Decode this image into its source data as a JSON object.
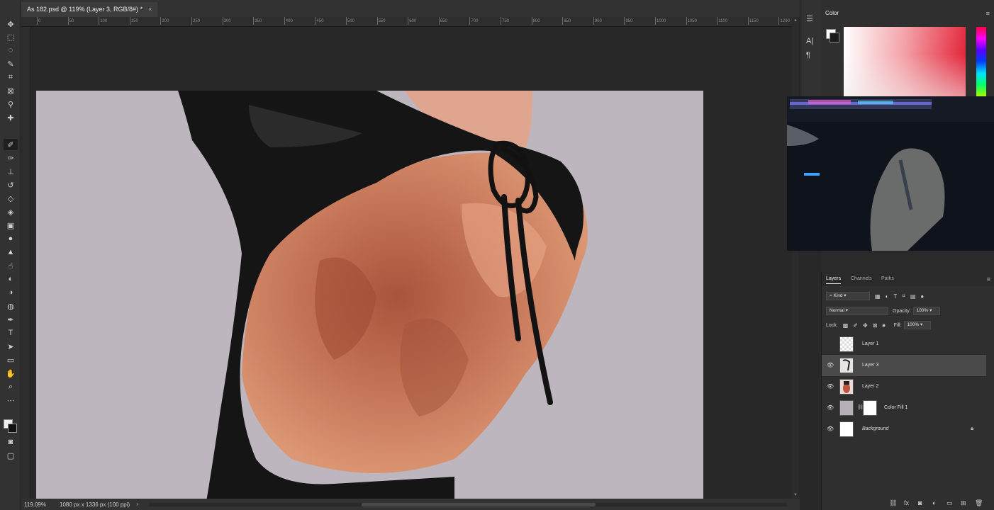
{
  "document": {
    "tab_title": "As 182.psd @ 119% (Layer 3, RGB/8#) *",
    "close_glyph": "×"
  },
  "ruler": {
    "ticks": [
      "0",
      "50",
      "100",
      "150",
      "200",
      "250",
      "300",
      "350",
      "400",
      "450",
      "500",
      "550",
      "600",
      "650",
      "700",
      "750",
      "800",
      "850",
      "900",
      "950",
      "1000",
      "1050",
      "1100",
      "1150",
      "1200"
    ]
  },
  "status": {
    "zoom": "119.09%",
    "dimensions": "1080 px x 1336 px (100 ppi)",
    "arrow": "›"
  },
  "toolbar": {
    "tools": [
      "move-icon",
      "marquee-icon",
      "lasso-icon",
      "quick-select-icon",
      "crop-icon",
      "frame-icon",
      "eyedropper-icon",
      "healing-icon",
      "brush-icon",
      "mixer-brush-icon",
      "clone-stamp-icon",
      "history-brush-icon",
      "eraser-icon",
      "paint-bucket-icon",
      "gradient-icon",
      "blur-icon",
      "sharpen-icon",
      "smudge-icon",
      "dodge-icon",
      "burn-icon",
      "sponge-icon",
      "pen-icon",
      "type-icon",
      "path-select-icon",
      "rectangle-icon",
      "hand-icon",
      "zoom-icon",
      "more-tools-icon"
    ]
  },
  "color_panel": {
    "title": "Color",
    "menu": "≡"
  },
  "layers_panel": {
    "tabs": [
      {
        "label": "Layers",
        "active": true
      },
      {
        "label": "Channels",
        "active": false
      },
      {
        "label": "Paths",
        "active": false
      }
    ],
    "filter_kind": "Kind",
    "blend_mode": "Normal",
    "opacity_label": "Opacity:",
    "opacity_value": "100%",
    "lock_label": "Lock:",
    "fill_label": "Fill:",
    "fill_value": "100%",
    "layers": [
      {
        "name": "Layer 1",
        "visible": false,
        "selected": false,
        "locked": false,
        "thumb": "transparent"
      },
      {
        "name": "Layer 3",
        "visible": true,
        "selected": true,
        "locked": false,
        "thumb": "strap"
      },
      {
        "name": "Layer 2",
        "visible": true,
        "selected": false,
        "locked": false,
        "thumb": "figure"
      },
      {
        "name": "Color Fill 1",
        "visible": true,
        "selected": false,
        "locked": false,
        "thumb": "fill"
      },
      {
        "name": "Background",
        "visible": true,
        "selected": false,
        "locked": true,
        "thumb": "white"
      }
    ]
  },
  "colors": {
    "app_bg": "#282828",
    "panel_bg": "#2f2f2f",
    "canvas_bg": "#bdb6bf",
    "skin": "#c8785a",
    "garment": "#161616",
    "accent_red": "#e3263a"
  }
}
